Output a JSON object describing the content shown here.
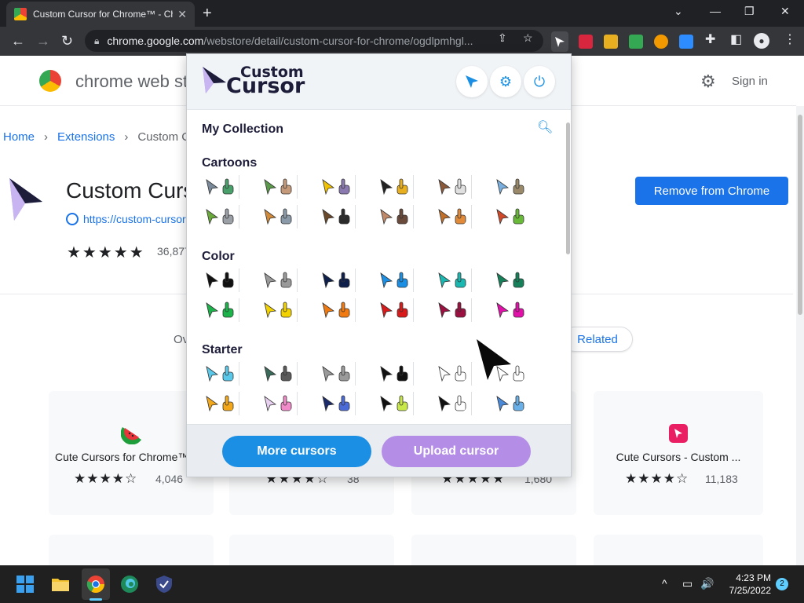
{
  "browser": {
    "tab_title": "Custom Cursor for Chrome™ - Ch",
    "tab_close": "✕",
    "new_tab": "+",
    "window_controls": {
      "minimize": "—",
      "restore": "❐",
      "close": "✕",
      "tabsearch": "⌄"
    },
    "url_host": "chrome.google.com",
    "url_path": "/webstore/detail/custom-cursor-for-chrome/ogdlpmhgl...",
    "nav": {
      "back": "←",
      "forward": "→",
      "reload": "↻"
    },
    "icons": [
      "lock-icon",
      "share-icon",
      "star-icon",
      "puzzle-icon",
      "sidepanel-icon",
      "profile-icon",
      "menu-icon"
    ]
  },
  "store": {
    "name": "chrome web store",
    "signin": "Sign in",
    "breadcrumb": [
      "Home",
      "Extensions",
      "Custom C"
    ],
    "ext_title": "Custom Cursor for Chrome™",
    "ext_link": "https://custom-cursor.com",
    "rating_count": "36,877",
    "remove_button": "Remove from Chrome",
    "tab_overview": "Overview",
    "tab_related": "Related",
    "cards": [
      {
        "title": "Cute Cursors for Chrome™",
        "rating": 4.5,
        "count": "4,046",
        "icon": "watermelon-icon"
      },
      {
        "title": "",
        "rating": 4.5,
        "count": "38",
        "icon": ""
      },
      {
        "title": "",
        "rating": 5,
        "count": "1,680",
        "icon": ""
      },
      {
        "title": "Cute Cursors - Custom ...",
        "rating": 4.5,
        "count": "11,183",
        "icon": "cursor-app-icon"
      }
    ],
    "stars_full": "★★★★★",
    "stars_card": "★★★★☆"
  },
  "popup": {
    "logo_top": "Custom",
    "logo_main": "Cursor",
    "my_collection": "My Collection",
    "categories": [
      "Cartoons",
      "Color",
      "Starter"
    ],
    "more_button": "More cursors",
    "upload_button": "Upload cursor",
    "colors": {
      "cartoons": [
        [
          "#7a8a9a",
          "#4aa06a"
        ],
        [
          "#5a9a4a",
          "#c49a7a"
        ],
        [
          "#f2c200",
          "#8a7ab0"
        ],
        [
          "#222222",
          "#e8b020"
        ],
        [
          "#8a5a3a",
          "#e0e0e0"
        ],
        [
          "#7ab0e0",
          "#9a8a6a"
        ],
        [
          "#6aaa3a",
          "#9aa0a6"
        ],
        [
          "#d08a3a",
          "#8a9aa8"
        ],
        [
          "#6a4a2a",
          "#2a2a2a"
        ],
        [
          "#c08a6a",
          "#6a4a3a"
        ],
        [
          "#c0702a",
          "#e08a3a"
        ],
        [
          "#d04a2a",
          "#6aba3a"
        ]
      ],
      "color": [
        [
          "#111111",
          "#111111"
        ],
        [
          "#9a9a9a",
          "#9a9a9a"
        ],
        [
          "#0d1f4a",
          "#0d1f4a"
        ],
        [
          "#1a8fe3",
          "#1a8fe3"
        ],
        [
          "#1ab8b0",
          "#1ab8b0"
        ],
        [
          "#15805a",
          "#15805a"
        ],
        [
          "#1bb34a",
          "#1bb34a"
        ],
        [
          "#f2d200",
          "#f2d200"
        ],
        [
          "#f07a10",
          "#f07a10"
        ],
        [
          "#d81a1a",
          "#d81a1a"
        ],
        [
          "#9a1040",
          "#9a1040"
        ],
        [
          "#e010a8",
          "#e010a8"
        ]
      ],
      "starter": [
        [
          "#5ac8e8",
          "#5ac8e8"
        ],
        [
          "#3a6a5a",
          "#5a5a5a"
        ],
        [
          "#9a9a9a",
          "#9a9a9a"
        ],
        [
          "#111111",
          "#111111"
        ],
        [
          "#ffffff",
          "#ffffff"
        ],
        [
          "#ffffff",
          "#ffffff"
        ],
        [
          "#f2a81a",
          "#f2a81a"
        ],
        [
          "#e8d0f0",
          "#f08ac8"
        ],
        [
          "#1a2a6a",
          "#4a6ad8"
        ],
        [
          "#111111",
          "#c8e84a"
        ],
        [
          "#111111",
          "#ffffff"
        ],
        [
          "#4a8ad8",
          "#6ab0e8"
        ]
      ]
    },
    "icons": [
      "cursor-toggle-icon",
      "settings-icon",
      "power-icon",
      "search-icon"
    ]
  },
  "taskbar": {
    "time": "4:23 PM",
    "date": "7/25/2022",
    "notification_count": "2",
    "tray": [
      "^",
      "▭",
      "🔊"
    ]
  }
}
